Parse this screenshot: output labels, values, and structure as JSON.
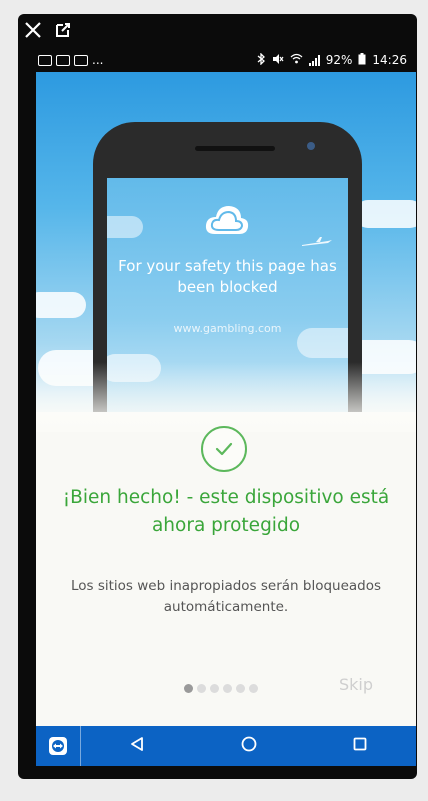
{
  "colors": {
    "accent_green": "#3aa63a",
    "nav_blue": "#0c63c4"
  },
  "top_tools": {
    "close_icon": "close-icon",
    "popout_icon": "external-window-icon"
  },
  "status_bar": {
    "left_text": "...",
    "battery": "92%",
    "time": "14:26"
  },
  "illustration": {
    "blocked_message": "For your safety this page has been blocked",
    "url": "www.gambling.com"
  },
  "main": {
    "headline": "¡Bien hecho! - este dispositivo está ahora protegido",
    "subtext": "Los sitios web inapropiados serán bloqueados automáticamente.",
    "skip_label": "Skip",
    "pager": {
      "total": 6,
      "active": 1
    }
  },
  "nav": {
    "app_icon": "teamviewer-icon",
    "back": "back-icon",
    "home": "home-icon",
    "recents": "recents-icon"
  }
}
